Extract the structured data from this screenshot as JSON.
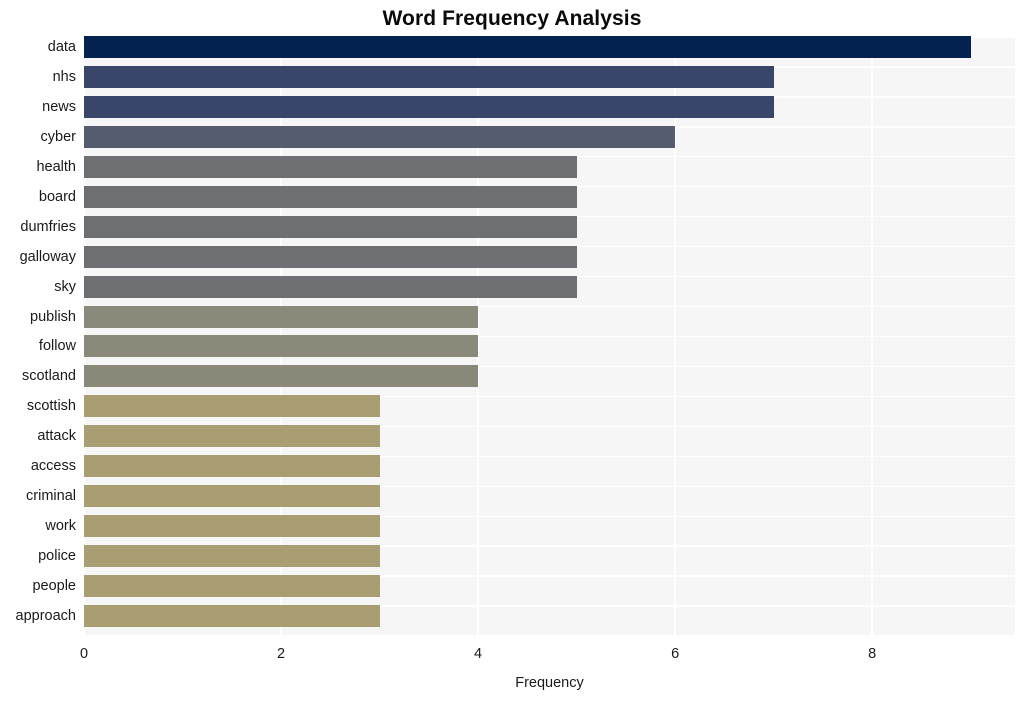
{
  "chart_data": {
    "type": "bar",
    "orientation": "horizontal",
    "title": "Word Frequency Analysis",
    "xlabel": "Frequency",
    "ylabel": "",
    "xlim": [
      0,
      9.45
    ],
    "xticks": [
      0,
      2,
      4,
      6,
      8
    ],
    "xtick_labels": [
      "0",
      "2",
      "4",
      "6",
      "8"
    ],
    "grid": true,
    "grid_color": "#ffffff",
    "plot_background": "#f6f6f7",
    "figure_background": "#ffffff",
    "legend": null,
    "categories": [
      "data",
      "nhs",
      "news",
      "cyber",
      "health",
      "board",
      "dumfries",
      "galloway",
      "sky",
      "publish",
      "follow",
      "scotland",
      "scottish",
      "attack",
      "access",
      "criminal",
      "work",
      "police",
      "people",
      "approach"
    ],
    "values": [
      9,
      7,
      7,
      6,
      5,
      5,
      5,
      5,
      5,
      4,
      4,
      4,
      3,
      3,
      3,
      3,
      3,
      3,
      3,
      3
    ],
    "bar_colors": [
      "#03224f",
      "#3a4669",
      "#3a4669",
      "#565c70",
      "#6e6f73",
      "#6e6f73",
      "#6e6f73",
      "#6e6f73",
      "#6e6f73",
      "#8b8979",
      "#8b8979",
      "#8a8879",
      "#a99e72",
      "#a99e72",
      "#a99e72",
      "#a99e72",
      "#a99e72",
      "#a99e72",
      "#a99e72",
      "#a99e72"
    ]
  }
}
